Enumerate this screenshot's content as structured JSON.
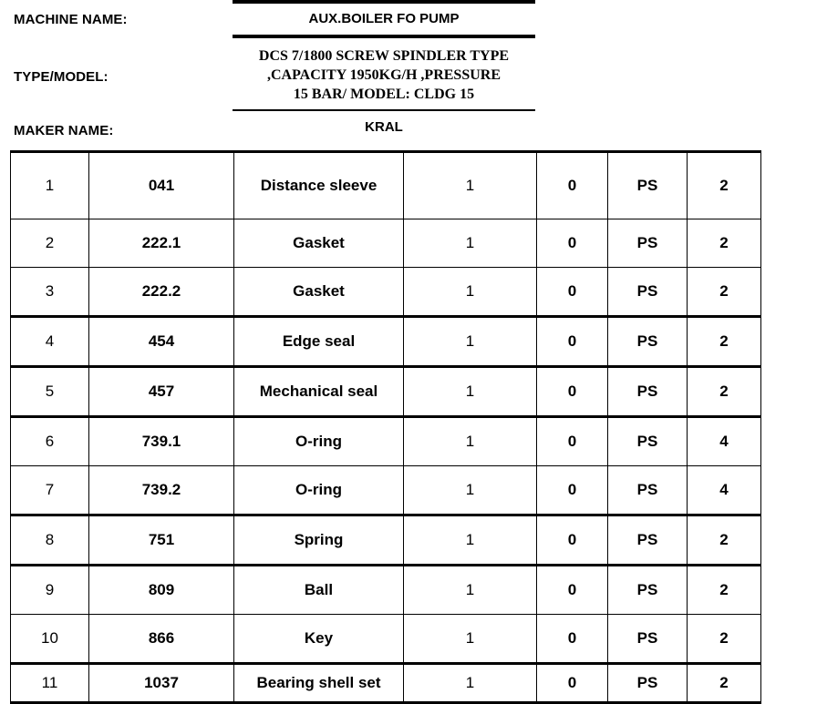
{
  "header": {
    "machine_label": "MACHINE NAME:",
    "machine_value": "AUX.BOILER FO PUMP",
    "type_label": "TYPE/MODEL:",
    "type_value_line1": "DCS 7/1800 SCREW SPINDLER TYPE",
    "type_value_line2": ",CAPACITY 1950KG/H ,PRESSURE",
    "type_value_line3": "15 BAR/ MODEL: CLDG 15",
    "maker_label": "MAKER NAME:",
    "maker_value": "KRAL"
  },
  "table": {
    "rows": [
      {
        "index": "1",
        "code": "041",
        "description": "Distance sleeve",
        "qty": "1",
        "stock": "0",
        "unit": "PS",
        "order": "2"
      },
      {
        "index": "2",
        "code": "222.1",
        "description": "Gasket",
        "qty": "1",
        "stock": "0",
        "unit": "PS",
        "order": "2"
      },
      {
        "index": "3",
        "code": "222.2",
        "description": "Gasket",
        "qty": "1",
        "stock": "0",
        "unit": "PS",
        "order": "2"
      },
      {
        "index": "4",
        "code": "454",
        "description": "Edge seal",
        "qty": "1",
        "stock": "0",
        "unit": "PS",
        "order": "2"
      },
      {
        "index": "5",
        "code": "457",
        "description": "Mechanical seal",
        "qty": "1",
        "stock": "0",
        "unit": "PS",
        "order": "2"
      },
      {
        "index": "6",
        "code": "739.1",
        "description": "O-ring",
        "qty": "1",
        "stock": "0",
        "unit": "PS",
        "order": "4"
      },
      {
        "index": "7",
        "code": "739.2",
        "description": "O-ring",
        "qty": "1",
        "stock": "0",
        "unit": "PS",
        "order": "4"
      },
      {
        "index": "8",
        "code": "751",
        "description": "Spring",
        "qty": "1",
        "stock": "0",
        "unit": "PS",
        "order": "2"
      },
      {
        "index": "9",
        "code": "809",
        "description": "Ball",
        "qty": "1",
        "stock": "0",
        "unit": "PS",
        "order": "2"
      },
      {
        "index": "10",
        "code": "866",
        "description": "Key",
        "qty": "1",
        "stock": "0",
        "unit": "PS",
        "order": "2"
      },
      {
        "index": "11",
        "code": "1037",
        "description": "Bearing shell set",
        "qty": "1",
        "stock": "0",
        "unit": "PS",
        "order": "2"
      }
    ]
  }
}
